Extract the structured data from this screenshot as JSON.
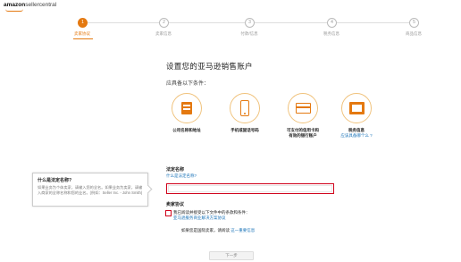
{
  "header": {
    "logo_amazon": "amazon",
    "logo_seller": "sellercentral"
  },
  "stepper": {
    "steps": [
      {
        "number": "1",
        "label": "卖家协议",
        "active": true
      },
      {
        "number": "2",
        "label": "卖家信息",
        "active": false
      },
      {
        "number": "3",
        "label": "付款/信息",
        "active": false
      },
      {
        "number": "4",
        "label": "税务信息",
        "active": false
      },
      {
        "number": "5",
        "label": "商品信息",
        "active": false
      }
    ]
  },
  "main": {
    "title": "设置您的亚马逊销售账户",
    "subtitle": "应具备以下条件："
  },
  "requirements": [
    {
      "icon": "building-icon",
      "label": "公司名称和地址",
      "link": ""
    },
    {
      "icon": "phone-icon",
      "label": "手机或固话号码",
      "link": ""
    },
    {
      "icon": "credit-card-icon",
      "label": "可支付的信用卡和\n有效的银行账户",
      "link": ""
    },
    {
      "icon": "id-card-icon",
      "label": "税务信息",
      "link": "应该具备哪个么 ?"
    }
  ],
  "tip": {
    "title": "什么是法定名称?",
    "body": "如果业务为个体卖家，请输入您的全名。如果业务为卖家，请输入商家的全称名称和您的业名。(例如：Seller Inc. - John Smith)"
  },
  "form": {
    "legal_name_label": "法定名称",
    "legal_name_link": "什么是法定名称?",
    "legal_name_value": "",
    "agreement_label": "卖家协议",
    "agreement_text": "我已阅读并接受以下文件中的条款和条件：",
    "agreement_link": "亚马逊服务商业解决方案协议",
    "foreign_text": "如果您是国际卖家，请阅读",
    "foreign_link": "这一重要信息"
  },
  "footer": {
    "next_label": "下一步"
  },
  "colors": {
    "accent": "#e47911",
    "link": "#1a73b8",
    "error": "#d0021b"
  }
}
